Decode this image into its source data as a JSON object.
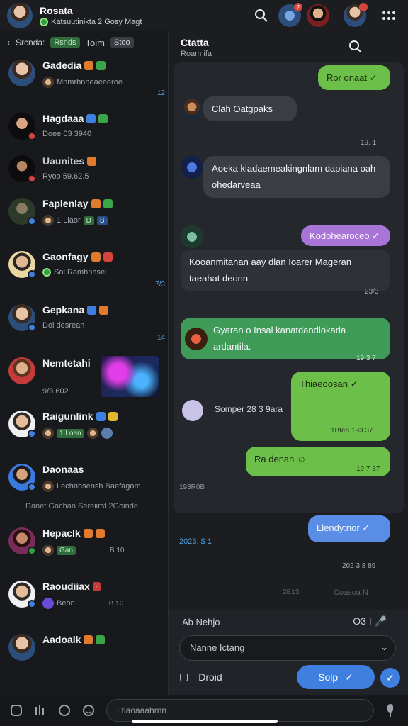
{
  "topbar": {
    "title": "Rosata",
    "subtitle": "Katsuutinikta 2 Gosy Magt",
    "badge": "2"
  },
  "chatlist": {
    "tabs": {
      "back": "Srcnda:",
      "active": "Rsnds",
      "tab2": "Toim",
      "tab3": "Stoo"
    },
    "rows": [
      {
        "name": "Gadedia",
        "sub": "Mnmrbnneaeeeroe",
        "time": "12"
      },
      {
        "name": "Hagdaaa",
        "sub": "Doee 03 3940",
        "time": ""
      },
      {
        "name": "Uaunites",
        "sub": "Ryoo 59.62.5",
        "time": ""
      },
      {
        "name": "Faplenlay",
        "sub": "1 Liaor",
        "pill1": "D",
        "pill2": "B",
        "time": ""
      },
      {
        "name": "Gaonfagy",
        "sub": "Sol Ramhnhsel",
        "time": "7/3"
      },
      {
        "name": "Gepkana",
        "sub": "Doi desrean",
        "time": "14"
      },
      {
        "name": "Nemtetahi",
        "sub": "9/3 602",
        "time": ""
      },
      {
        "name": "Raigunlink",
        "sub": "1 Loan",
        "time": ""
      },
      {
        "name": "Daonaas",
        "sub": "Lechnhsensh Baefagom,",
        "extra": "Danet Gachan Sereiirst 2Goinde",
        "time": ""
      },
      {
        "name": "Hepaclk",
        "sub": "Gan",
        "pill": "B 10",
        "time": ""
      },
      {
        "name": "Raoudiiax",
        "sub": "Beon",
        "pill": "B 10",
        "time": ""
      },
      {
        "name": "Aadoalk",
        "sub": "",
        "time": ""
      }
    ]
  },
  "chat": {
    "name": "Ctatta",
    "status": "Roam ifa",
    "messages": [
      {
        "text": "Ror onaat",
        "type": "out"
      },
      {
        "text": "Clah Oatgpaks",
        "type": "in",
        "time": "19. 1"
      },
      {
        "text": "Aoeka kladaemeakingnlam dapiana oah ohedarveaa",
        "type": "in"
      },
      {
        "text": "Kodohearoceo",
        "type": "purple"
      },
      {
        "text": "Kooanmitanan aay dlan Ioarer Mageran taeahat deonn",
        "type": "in",
        "time": "23/3"
      },
      {
        "text": "Gyaran o Insal kanatdandlokaria ardantila.",
        "type": "teal",
        "time": "19 3 7"
      },
      {
        "text": "Thiaeoosan",
        "type": "out",
        "time": "1Bteh 193 37"
      },
      {
        "text": "Somper 28 3 9ara",
        "type": "note"
      },
      {
        "text": "Ra denan",
        "type": "out",
        "time": "19 7 37"
      },
      {
        "text": "Llendy:nor",
        "type": "blue"
      }
    ],
    "meta": {
      "day": "193R0B",
      "left": "2023. $ 1",
      "date": "202 3 8 89",
      "row": "2B13",
      "rowb": "Coasoa N"
    }
  },
  "composer": {
    "label": "Ab Nehjo",
    "icons": "O3 I",
    "field": "Nanne Ictang",
    "draft": "Droid",
    "send": "Solp"
  },
  "bottom": {
    "placeholder": "Ltiaoaaahrnn"
  },
  "colors": {
    "accent": "#3e7fe0",
    "green": "#6cc04a",
    "purple": "#a974d8"
  }
}
